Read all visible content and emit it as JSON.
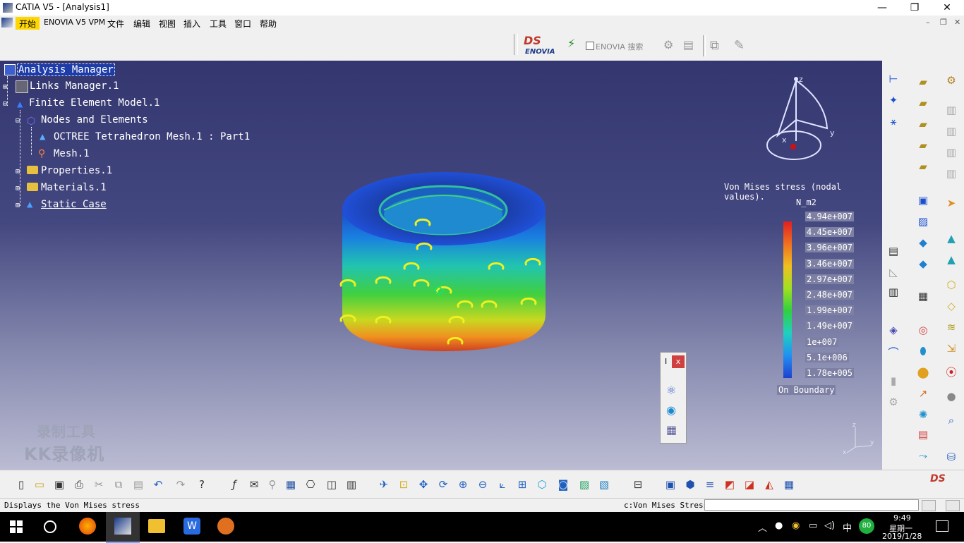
{
  "window": {
    "title": "CATIA V5 - [Analysis1]",
    "min": "—",
    "max": "❐",
    "close": "✕"
  },
  "menubar": {
    "items": [
      "开始",
      "ENOVIA V5 VPM",
      "文件",
      "编辑",
      "视图",
      "插入",
      "工具",
      "窗口",
      "帮助"
    ],
    "doc_min": "–",
    "doc_restore": "❐",
    "doc_close": "✕"
  },
  "toolstrip": {
    "enovia_logo": "ENOVIA",
    "search_label": "ENOVIA 搜索"
  },
  "tree": {
    "root": "Analysis Manager",
    "links": "Links Manager.1",
    "fem": "Finite Element Model.1",
    "nodes": "Nodes and Elements",
    "octree": "OCTREE Tetrahedron Mesh.1 : Part1",
    "mesh": "Mesh.1",
    "properties": "Properties.1",
    "materials": "Materials.1",
    "static_case": "Static Case"
  },
  "legend": {
    "title": "Von Mises stress (nodal values).",
    "unit": "N_m2",
    "ticks": [
      "4.94e+007",
      "4.45e+007",
      "3.96e+007",
      "3.46e+007",
      "2.97e+007",
      "2.48e+007",
      "1.99e+007",
      "1.49e+007",
      "1e+007",
      "5.1e+006",
      "1.78e+005"
    ],
    "footer": "On Boundary"
  },
  "compass": {
    "z": "z",
    "y": "y",
    "x": "x"
  },
  "mini_axis": {
    "z": "z",
    "y": "y",
    "x": "x"
  },
  "watermark": {
    "line1": "录制工具",
    "line2": "KK录像机"
  },
  "floating_toolbar": {
    "title": "I",
    "close": "x"
  },
  "statusbar": {
    "message": "Displays the Von Mises stress",
    "command_label": "c:Von Mises Stress",
    "command_value": ""
  },
  "taskbar": {
    "time": "9:49",
    "day": "星期一",
    "date": "2019/1/28",
    "ime": "中",
    "badge": "80"
  },
  "colors": {
    "accent_menu": "#ffd700",
    "viewport_top": "#34376f",
    "tree_selection": "#1e3ca8"
  }
}
